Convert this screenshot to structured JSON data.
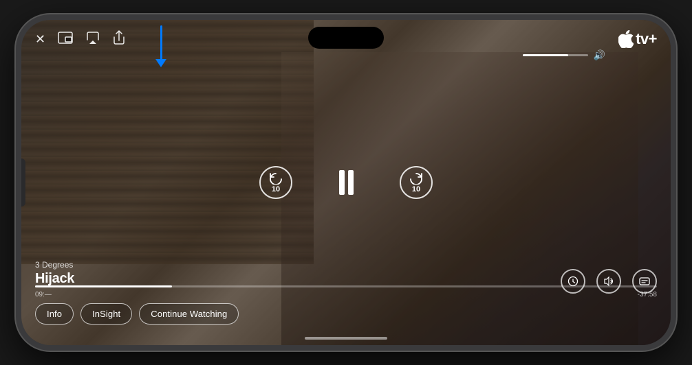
{
  "phone": {
    "title": "iPhone with Apple TV+ video player"
  },
  "player": {
    "show_subtitle": "3 Degrees",
    "show_title": "Hijack",
    "time_current": "09:—",
    "time_remaining": "-37:58",
    "volume_percent": 70,
    "progress_percent": 22,
    "app_name": "tv+",
    "app_logo": ""
  },
  "top_controls": {
    "close_label": "✕",
    "picture_in_picture_label": "⧉",
    "airplay_label": "⬆",
    "share_label": "↑"
  },
  "playback_controls": {
    "rewind_label": "10",
    "pause_label": "❚❚",
    "forward_label": "10"
  },
  "right_controls": {
    "speed_label": "◎",
    "audio_label": "≋",
    "subtitles_label": "⬜"
  },
  "bottom_buttons": [
    {
      "id": "info",
      "label": "Info"
    },
    {
      "id": "insight",
      "label": "InSight"
    },
    {
      "id": "continue",
      "label": "Continue Watching"
    }
  ],
  "arrow_indicator": {
    "color": "#007AFF"
  }
}
